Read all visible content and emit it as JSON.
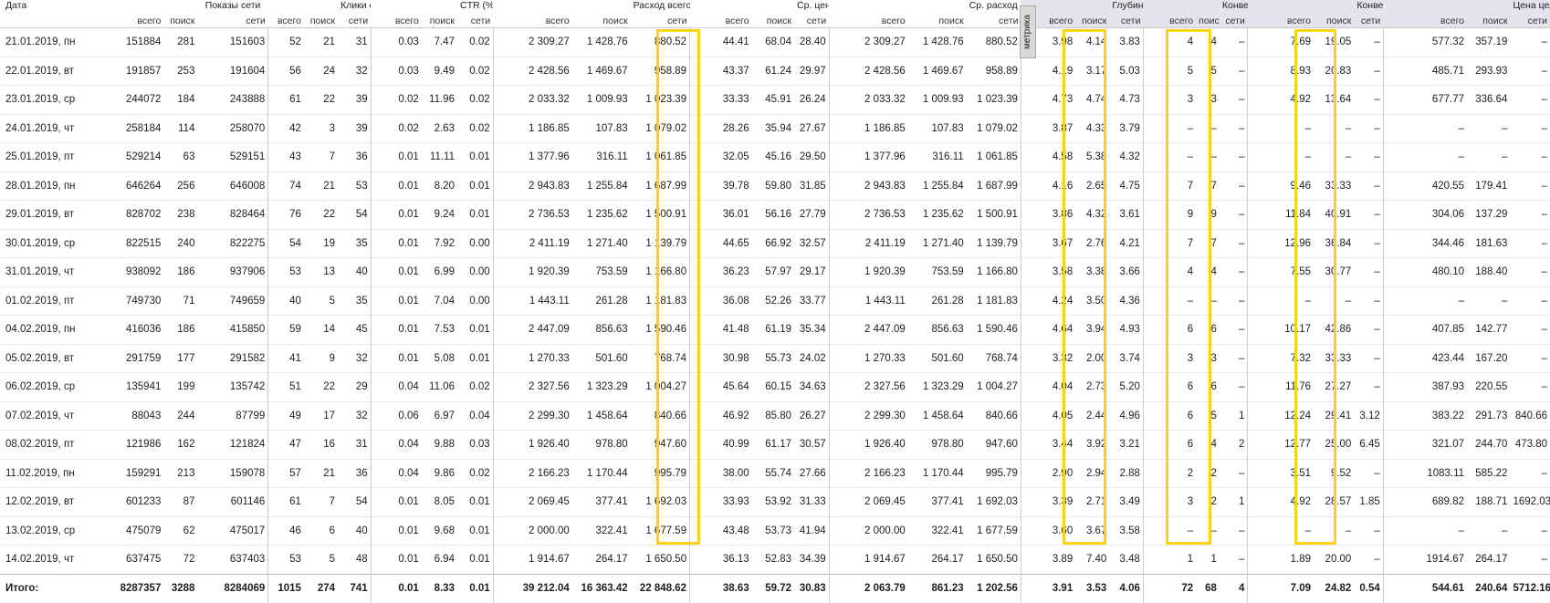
{
  "headers": {
    "date": "Дата",
    "shows": "Показы сети",
    "clicks": "Клики сети",
    "ctr": "CTR (%)",
    "spend": "Расход всего, руб.",
    "cpc": "Ср. цена клика, руб.",
    "daily": "Ср. расход за день, руб.",
    "depth": "Глубина (стр.)",
    "conv": "Конверсии",
    "convrate": "Конверсия (%)",
    "cpa": "Цена цели, руб.",
    "sub_all": "всего",
    "sub_search": "поиск",
    "sub_net": "сети"
  },
  "metrika_tab": "метрика",
  "rows": [
    {
      "date": "21.01.2019, пн",
      "c": [
        "151884",
        "281",
        "151603",
        "52",
        "21",
        "31",
        "0.03",
        "7.47",
        "0.02",
        "2 309.27",
        "1 428.76",
        "880.52",
        "44.41",
        "68.04",
        "28.40",
        "2 309.27",
        "1 428.76",
        "880.52",
        "3.98",
        "4.14",
        "3.83",
        "4",
        "4",
        "–",
        "7.69",
        "19.05",
        "–",
        "577.32",
        "357.19",
        "–"
      ]
    },
    {
      "date": "22.01.2019, вт",
      "c": [
        "191857",
        "253",
        "191604",
        "56",
        "24",
        "32",
        "0.03",
        "9.49",
        "0.02",
        "2 428.56",
        "1 469.67",
        "958.89",
        "43.37",
        "61.24",
        "29.97",
        "2 428.56",
        "1 469.67",
        "958.89",
        "4.19",
        "3.17",
        "5.03",
        "5",
        "5",
        "–",
        "8.93",
        "20.83",
        "–",
        "485.71",
        "293.93",
        "–"
      ]
    },
    {
      "date": "23.01.2019, ср",
      "c": [
        "244072",
        "184",
        "243888",
        "61",
        "22",
        "39",
        "0.02",
        "11.96",
        "0.02",
        "2 033.32",
        "1 009.93",
        "1 023.39",
        "33.33",
        "45.91",
        "26.24",
        "2 033.32",
        "1 009.93",
        "1 023.39",
        "4.73",
        "4.74",
        "4.73",
        "3",
        "3",
        "–",
        "4.92",
        "13.64",
        "–",
        "677.77",
        "336.64",
        "–"
      ]
    },
    {
      "date": "24.01.2019, чт",
      "c": [
        "258184",
        "114",
        "258070",
        "42",
        "3",
        "39",
        "0.02",
        "2.63",
        "0.02",
        "1 186.85",
        "107.83",
        "1 079.02",
        "28.26",
        "35.94",
        "27.67",
        "1 186.85",
        "107.83",
        "1 079.02",
        "3.87",
        "4.33",
        "3.79",
        "–",
        "–",
        "–",
        "–",
        "–",
        "–",
        "–",
        "–",
        "–"
      ]
    },
    {
      "date": "25.01.2019, пт",
      "c": [
        "529214",
        "63",
        "529151",
        "43",
        "7",
        "36",
        "0.01",
        "11.11",
        "0.01",
        "1 377.96",
        "316.11",
        "1 061.85",
        "32.05",
        "45.16",
        "29.50",
        "1 377.96",
        "316.11",
        "1 061.85",
        "4.58",
        "5.38",
        "4.32",
        "–",
        "–",
        "–",
        "–",
        "–",
        "–",
        "–",
        "–",
        "–"
      ]
    },
    {
      "date": "28.01.2019, пн",
      "c": [
        "646264",
        "256",
        "646008",
        "74",
        "21",
        "53",
        "0.01",
        "8.20",
        "0.01",
        "2 943.83",
        "1 255.84",
        "1 687.99",
        "39.78",
        "59.80",
        "31.85",
        "2 943.83",
        "1 255.84",
        "1 687.99",
        "4.16",
        "2.65",
        "4.75",
        "7",
        "7",
        "–",
        "9.46",
        "33.33",
        "–",
        "420.55",
        "179.41",
        "–"
      ]
    },
    {
      "date": "29.01.2019, вт",
      "c": [
        "828702",
        "238",
        "828464",
        "76",
        "22",
        "54",
        "0.01",
        "9.24",
        "0.01",
        "2 736.53",
        "1 235.62",
        "1 500.91",
        "36.01",
        "56.16",
        "27.79",
        "2 736.53",
        "1 235.62",
        "1 500.91",
        "3.86",
        "4.32",
        "3.61",
        "9",
        "9",
        "–",
        "11.84",
        "40.91",
        "–",
        "304.06",
        "137.29",
        "–"
      ]
    },
    {
      "date": "30.01.2019, ср",
      "c": [
        "822515",
        "240",
        "822275",
        "54",
        "19",
        "35",
        "0.01",
        "7.92",
        "0.00",
        "2 411.19",
        "1 271.40",
        "1 139.79",
        "44.65",
        "66.92",
        "32.57",
        "2 411.19",
        "1 271.40",
        "1 139.79",
        "3.67",
        "2.76",
        "4.21",
        "7",
        "7",
        "–",
        "12.96",
        "36.84",
        "–",
        "344.46",
        "181.63",
        "–"
      ]
    },
    {
      "date": "31.01.2019, чт",
      "c": [
        "938092",
        "186",
        "937906",
        "53",
        "13",
        "40",
        "0.01",
        "6.99",
        "0.00",
        "1 920.39",
        "753.59",
        "1 166.80",
        "36.23",
        "57.97",
        "29.17",
        "1 920.39",
        "753.59",
        "1 166.80",
        "3.58",
        "3.38",
        "3.66",
        "4",
        "4",
        "–",
        "7.55",
        "30.77",
        "–",
        "480.10",
        "188.40",
        "–"
      ]
    },
    {
      "date": "01.02.2019, пт",
      "c": [
        "749730",
        "71",
        "749659",
        "40",
        "5",
        "35",
        "0.01",
        "7.04",
        "0.00",
        "1 443.11",
        "261.28",
        "1 181.83",
        "36.08",
        "52.26",
        "33.77",
        "1 443.11",
        "261.28",
        "1 181.83",
        "4.24",
        "3.50",
        "4.36",
        "–",
        "–",
        "–",
        "–",
        "–",
        "–",
        "–",
        "–",
        "–"
      ]
    },
    {
      "date": "04.02.2019, пн",
      "c": [
        "416036",
        "186",
        "415850",
        "59",
        "14",
        "45",
        "0.01",
        "7.53",
        "0.01",
        "2 447.09",
        "856.63",
        "1 590.46",
        "41.48",
        "61.19",
        "35.34",
        "2 447.09",
        "856.63",
        "1 590.46",
        "4.64",
        "3.94",
        "4.93",
        "6",
        "6",
        "–",
        "10.17",
        "42.86",
        "–",
        "407.85",
        "142.77",
        "–"
      ]
    },
    {
      "date": "05.02.2019, вт",
      "c": [
        "291759",
        "177",
        "291582",
        "41",
        "9",
        "32",
        "0.01",
        "5.08",
        "0.01",
        "1 270.33",
        "501.60",
        "768.74",
        "30.98",
        "55.73",
        "24.02",
        "1 270.33",
        "501.60",
        "768.74",
        "3.32",
        "2.00",
        "3.74",
        "3",
        "3",
        "–",
        "7.32",
        "33.33",
        "–",
        "423.44",
        "167.20",
        "–"
      ]
    },
    {
      "date": "06.02.2019, ср",
      "c": [
        "135941",
        "199",
        "135742",
        "51",
        "22",
        "29",
        "0.04",
        "11.06",
        "0.02",
        "2 327.56",
        "1 323.29",
        "1 004.27",
        "45.64",
        "60.15",
        "34.63",
        "2 327.56",
        "1 323.29",
        "1 004.27",
        "4.04",
        "2.73",
        "5.20",
        "6",
        "6",
        "–",
        "11.76",
        "27.27",
        "–",
        "387.93",
        "220.55",
        "–"
      ]
    },
    {
      "date": "07.02.2019, чт",
      "c": [
        "88043",
        "244",
        "87799",
        "49",
        "17",
        "32",
        "0.06",
        "6.97",
        "0.04",
        "2 299.30",
        "1 458.64",
        "840.66",
        "46.92",
        "85.80",
        "26.27",
        "2 299.30",
        "1 458.64",
        "840.66",
        "4.05",
        "2.44",
        "4.96",
        "6",
        "5",
        "1",
        "12.24",
        "29.41",
        "3.12",
        "383.22",
        "291.73",
        "840.66"
      ]
    },
    {
      "date": "08.02.2019, пт",
      "c": [
        "121986",
        "162",
        "121824",
        "47",
        "16",
        "31",
        "0.04",
        "9.88",
        "0.03",
        "1 926.40",
        "978.80",
        "947.60",
        "40.99",
        "61.17",
        "30.57",
        "1 926.40",
        "978.80",
        "947.60",
        "3.44",
        "3.92",
        "3.21",
        "6",
        "4",
        "2",
        "12.77",
        "25.00",
        "6.45",
        "321.07",
        "244.70",
        "473.80"
      ]
    },
    {
      "date": "11.02.2019, пн",
      "c": [
        "159291",
        "213",
        "159078",
        "57",
        "21",
        "36",
        "0.04",
        "9.86",
        "0.02",
        "2 166.23",
        "1 170.44",
        "995.79",
        "38.00",
        "55.74",
        "27.66",
        "2 166.23",
        "1 170.44",
        "995.79",
        "2.90",
        "2.94",
        "2.88",
        "2",
        "2",
        "–",
        "3.51",
        "9.52",
        "–",
        "1083.11",
        "585.22",
        "–"
      ]
    },
    {
      "date": "12.02.2019, вт",
      "c": [
        "601233",
        "87",
        "601146",
        "61",
        "7",
        "54",
        "0.01",
        "8.05",
        "0.01",
        "2 069.45",
        "377.41",
        "1 692.03",
        "33.93",
        "53.92",
        "31.33",
        "2 069.45",
        "377.41",
        "1 692.03",
        "3.39",
        "2.71",
        "3.49",
        "3",
        "2",
        "1",
        "4.92",
        "28.57",
        "1.85",
        "689.82",
        "188.71",
        "1692.03"
      ]
    },
    {
      "date": "13.02.2019, ср",
      "c": [
        "475079",
        "62",
        "475017",
        "46",
        "6",
        "40",
        "0.01",
        "9.68",
        "0.01",
        "2 000.00",
        "322.41",
        "1 677.59",
        "43.48",
        "53.73",
        "41.94",
        "2 000.00",
        "322.41",
        "1 677.59",
        "3.60",
        "3.67",
        "3.58",
        "–",
        "–",
        "–",
        "–",
        "–",
        "–",
        "–",
        "–",
        "–"
      ]
    },
    {
      "date": "14.02.2019, чт",
      "c": [
        "637475",
        "72",
        "637403",
        "53",
        "5",
        "48",
        "0.01",
        "6.94",
        "0.01",
        "1 914.67",
        "264.17",
        "1 650.50",
        "36.13",
        "52.83",
        "34.39",
        "1 914.67",
        "264.17",
        "1 650.50",
        "3.89",
        "7.40",
        "3.48",
        "1",
        "1",
        "–",
        "1.89",
        "20.00",
        "–",
        "1914.67",
        "264.17",
        "–"
      ]
    }
  ],
  "total": {
    "label": "Итого:",
    "c": [
      "8287357",
      "3288",
      "8284069",
      "1015",
      "274",
      "741",
      "0.01",
      "8.33",
      "0.01",
      "39 212.04",
      "16 363.42",
      "22 848.62",
      "38.63",
      "59.72",
      "30.83",
      "2 063.79",
      "861.23",
      "1 202.56",
      "3.91",
      "3.53",
      "4.06",
      "72",
      "68",
      "4",
      "7.09",
      "24.82",
      "0.54",
      "544.61",
      "240.64",
      "5712.16"
    ]
  }
}
